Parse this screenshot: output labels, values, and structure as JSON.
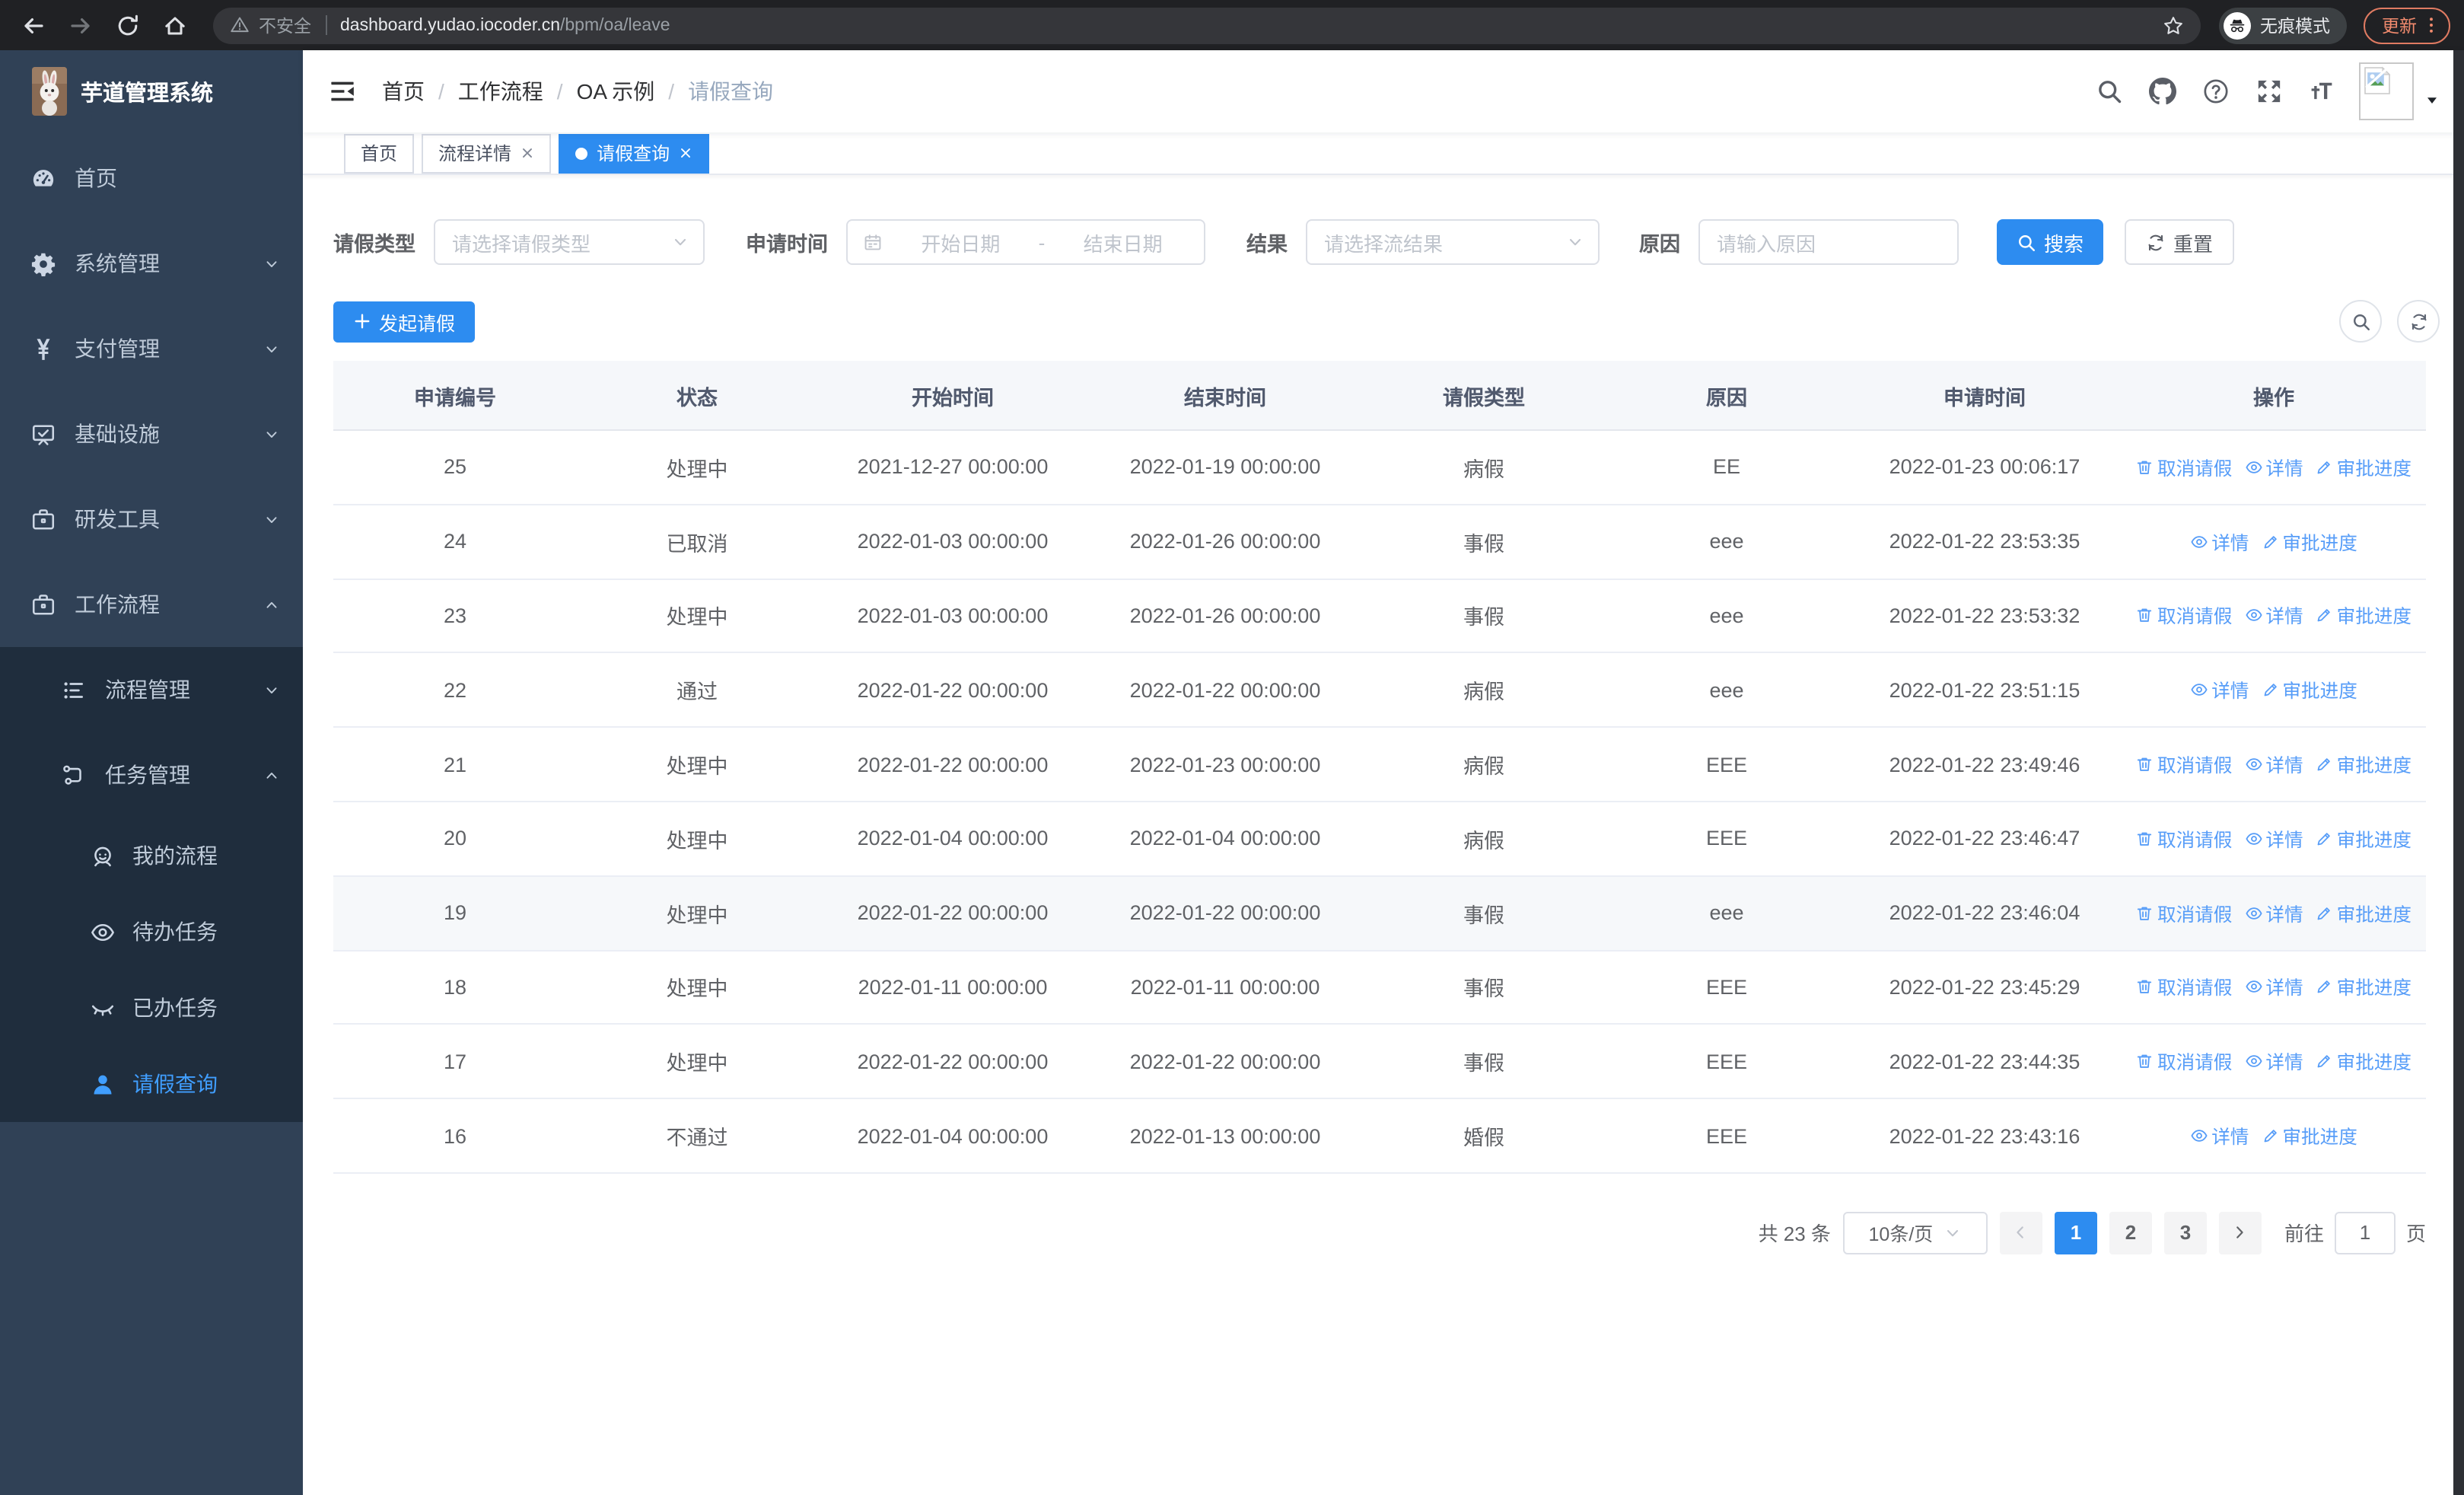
{
  "browser": {
    "security_label": "不安全",
    "url_host": "dashboard.yudao.iocoder.cn",
    "url_path": "/bpm/oa/leave",
    "incognito_label": "无痕模式",
    "update_label": "更新"
  },
  "colors": {
    "accent": "#2d8cf0",
    "link_blue": "#579df8",
    "sidebar_bg": "#304156",
    "submenu_bg": "#1f2d3d",
    "active_menu_text": "#409eff",
    "update_accent": "#f28b6e"
  },
  "sidebar": {
    "title": "芋道管理系统",
    "items": [
      {
        "key": "home",
        "label": "首页",
        "icon": "dashboard",
        "level": 1,
        "arrow": null,
        "active": false
      },
      {
        "key": "system",
        "label": "系统管理",
        "icon": "gear",
        "level": 1,
        "arrow": "down",
        "active": false
      },
      {
        "key": "payment",
        "label": "支付管理",
        "icon": "yuan",
        "level": 1,
        "arrow": "down",
        "active": false
      },
      {
        "key": "infrastructure",
        "label": "基础设施",
        "icon": "monitor",
        "level": 1,
        "arrow": "down",
        "active": false
      },
      {
        "key": "devtools",
        "label": "研发工具",
        "icon": "briefcase",
        "level": 1,
        "arrow": "down",
        "active": false
      },
      {
        "key": "workflow",
        "label": "工作流程",
        "icon": "briefcase",
        "level": 1,
        "arrow": "up",
        "active": false
      },
      {
        "key": "process-management",
        "label": "流程管理",
        "icon": "list",
        "level": 2,
        "arrow": "down",
        "active": false
      },
      {
        "key": "task-management",
        "label": "任务管理",
        "icon": "flow",
        "level": 2,
        "arrow": "up",
        "active": false
      },
      {
        "key": "my-process",
        "label": "我的流程",
        "icon": "face",
        "level": 3,
        "arrow": null,
        "active": false
      },
      {
        "key": "todo-tasks",
        "label": "待办任务",
        "icon": "eye-open",
        "level": 3,
        "arrow": null,
        "active": false
      },
      {
        "key": "done-tasks",
        "label": "已办任务",
        "icon": "eye-closed",
        "level": 3,
        "arrow": null,
        "active": false
      },
      {
        "key": "leave-query",
        "label": "请假查询",
        "icon": "user",
        "level": 3,
        "arrow": null,
        "active": true
      }
    ]
  },
  "header": {
    "breadcrumb": {
      "items": [
        "首页",
        "工作流程",
        "OA 示例",
        "请假查询"
      ],
      "separator": "/"
    },
    "icons": [
      {
        "key": "search"
      },
      {
        "key": "github"
      },
      {
        "key": "help"
      },
      {
        "key": "fullscreen"
      },
      {
        "key": "font-size"
      }
    ]
  },
  "tabs": [
    {
      "label": "首页",
      "closable": false,
      "active": false
    },
    {
      "label": "流程详情",
      "closable": true,
      "active": false
    },
    {
      "label": "请假查询",
      "closable": true,
      "active": true
    }
  ],
  "filters": {
    "leave_type_label": "请假类型",
    "leave_type_placeholder": "请选择请假类型",
    "apply_time_label": "申请时间",
    "start_date_placeholder": "开始日期",
    "range_separator": "-",
    "end_date_placeholder": "结束日期",
    "result_label": "结果",
    "result_placeholder": "请选择流结果",
    "reason_label": "原因",
    "reason_placeholder": "请输入原因",
    "search_label": "搜索",
    "reset_label": "重置"
  },
  "toolbar": {
    "create_label": "发起请假",
    "icons": [
      {
        "key": "search"
      },
      {
        "key": "refresh"
      }
    ]
  },
  "table": {
    "columns": [
      "申请编号",
      "状态",
      "开始时间",
      "结束时间",
      "请假类型",
      "原因",
      "申请时间",
      "操作"
    ],
    "action_labels": {
      "cancel": {
        "label": "取消请假",
        "icon": "delete"
      },
      "detail": {
        "label": "详情",
        "icon": "eye-open"
      },
      "progress": {
        "label": "审批进度",
        "icon": "pen"
      }
    },
    "rows": [
      {
        "id": "25",
        "status": "处理中",
        "start": "2021-12-27 00:00:00",
        "end": "2022-01-19 00:00:00",
        "type": "病假",
        "reason": "EE",
        "applied": "2022-01-23 00:06:17",
        "actions": [
          "cancel",
          "detail",
          "progress"
        ],
        "highlight": false
      },
      {
        "id": "24",
        "status": "已取消",
        "start": "2022-01-03 00:00:00",
        "end": "2022-01-26 00:00:00",
        "type": "事假",
        "reason": "eee",
        "applied": "2022-01-22 23:53:35",
        "actions": [
          "detail",
          "progress"
        ],
        "highlight": false
      },
      {
        "id": "23",
        "status": "处理中",
        "start": "2022-01-03 00:00:00",
        "end": "2022-01-26 00:00:00",
        "type": "事假",
        "reason": "eee",
        "applied": "2022-01-22 23:53:32",
        "actions": [
          "cancel",
          "detail",
          "progress"
        ],
        "highlight": false
      },
      {
        "id": "22",
        "status": "通过",
        "start": "2022-01-22 00:00:00",
        "end": "2022-01-22 00:00:00",
        "type": "病假",
        "reason": "eee",
        "applied": "2022-01-22 23:51:15",
        "actions": [
          "detail",
          "progress"
        ],
        "highlight": false
      },
      {
        "id": "21",
        "status": "处理中",
        "start": "2022-01-22 00:00:00",
        "end": "2022-01-23 00:00:00",
        "type": "病假",
        "reason": "EEE",
        "applied": "2022-01-22 23:49:46",
        "actions": [
          "cancel",
          "detail",
          "progress"
        ],
        "highlight": false
      },
      {
        "id": "20",
        "status": "处理中",
        "start": "2022-01-04 00:00:00",
        "end": "2022-01-04 00:00:00",
        "type": "病假",
        "reason": "EEE",
        "applied": "2022-01-22 23:46:47",
        "actions": [
          "cancel",
          "detail",
          "progress"
        ],
        "highlight": false
      },
      {
        "id": "19",
        "status": "处理中",
        "start": "2022-01-22 00:00:00",
        "end": "2022-01-22 00:00:00",
        "type": "事假",
        "reason": "eee",
        "applied": "2022-01-22 23:46:04",
        "actions": [
          "cancel",
          "detail",
          "progress"
        ],
        "highlight": true
      },
      {
        "id": "18",
        "status": "处理中",
        "start": "2022-01-11 00:00:00",
        "end": "2022-01-11 00:00:00",
        "type": "事假",
        "reason": "EEE",
        "applied": "2022-01-22 23:45:29",
        "actions": [
          "cancel",
          "detail",
          "progress"
        ],
        "highlight": false
      },
      {
        "id": "17",
        "status": "处理中",
        "start": "2022-01-22 00:00:00",
        "end": "2022-01-22 00:00:00",
        "type": "事假",
        "reason": "EEE",
        "applied": "2022-01-22 23:44:35",
        "actions": [
          "cancel",
          "detail",
          "progress"
        ],
        "highlight": false
      },
      {
        "id": "16",
        "status": "不通过",
        "start": "2022-01-04 00:00:00",
        "end": "2022-01-13 00:00:00",
        "type": "婚假",
        "reason": "EEE",
        "applied": "2022-01-22 23:43:16",
        "actions": [
          "detail",
          "progress"
        ],
        "highlight": false
      }
    ]
  },
  "pagination": {
    "total_label": "共 23 条",
    "page_size": "10条/页",
    "pages": [
      "1",
      "2",
      "3"
    ],
    "active_page": "1",
    "goto_label": "前往",
    "goto_value": "1",
    "goto_suffix": "页"
  }
}
